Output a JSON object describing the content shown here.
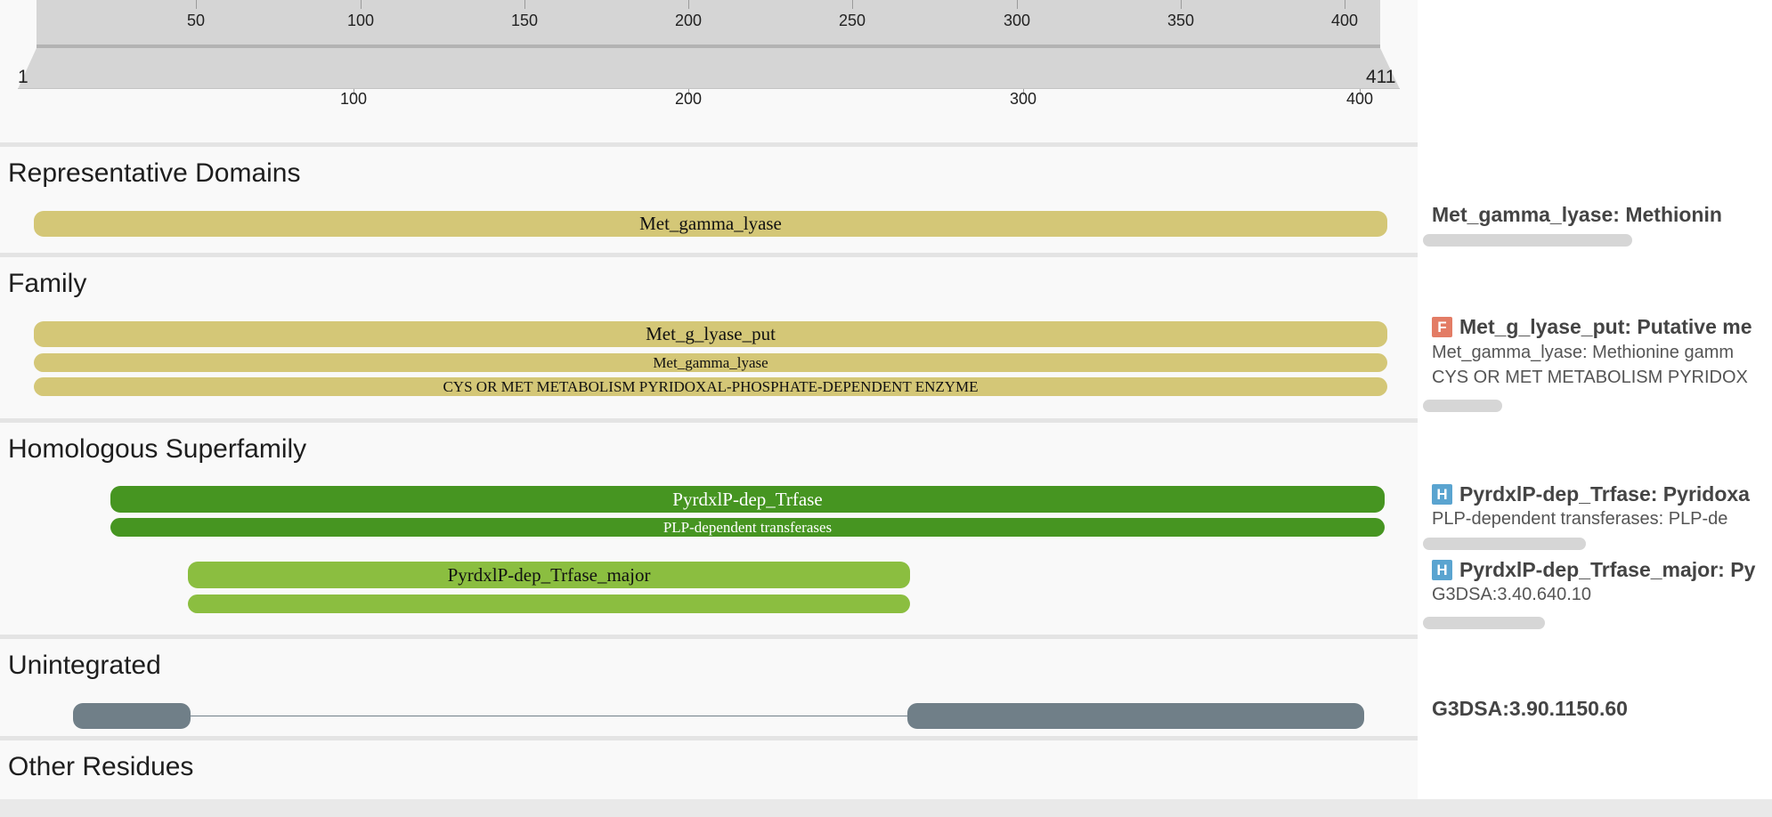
{
  "ruler": {
    "zoom_ticks": [
      "50",
      "100",
      "150",
      "200",
      "250",
      "300",
      "350",
      "400"
    ],
    "range_start": "1",
    "range_end": "411",
    "full_ticks": [
      "100",
      "200",
      "300",
      "400"
    ]
  },
  "sections": {
    "representative_domains": "Representative Domains",
    "family": "Family",
    "homologous_superfamily": "Homologous Superfamily",
    "unintegrated": "Unintegrated",
    "other_residues": "Other Residues"
  },
  "tracks": {
    "rep_domain": "Met_gamma_lyase",
    "family_main": "Met_g_lyase_put",
    "family_sub1": "Met_gamma_lyase",
    "family_sub2": "CYS OR MET METABOLISM PYRIDOXAL-PHOSPHATE-DEPENDENT ENZYME",
    "hs1_main": "PyrdxlP-dep_Trfase",
    "hs1_sub": "PLP-dependent transferases",
    "hs2_main": "PyrdxlP-dep_Trfase_major",
    "hs2_sub": ""
  },
  "labels": {
    "rep_domain_title": "Met_gamma_lyase: Methionin",
    "family_badge": "F",
    "family_title": "Met_g_lyase_put: Putative me",
    "family_sub1": "Met_gamma_lyase: Methionine gamm",
    "family_sub2": "CYS OR MET METABOLISM PYRIDOX",
    "hs_badge": "H",
    "hs1_title": "PyrdxlP-dep_Trfase: Pyridoxa",
    "hs1_sub": "PLP-dependent transferases: PLP-de",
    "hs2_title": "PyrdxlP-dep_Trfase_major: Py",
    "hs2_sub": "G3DSA:3.40.640.10",
    "unintegrated_title": "G3DSA:3.90.1150.60"
  },
  "colors": {
    "domain_tan": "#d4c777",
    "superfamily_dark_green": "#469521",
    "superfamily_light_green": "#8bbe40",
    "unintegrated_slate": "#707f88",
    "family_badge": "#e37c65",
    "homologous_badge": "#5aa4d0"
  }
}
